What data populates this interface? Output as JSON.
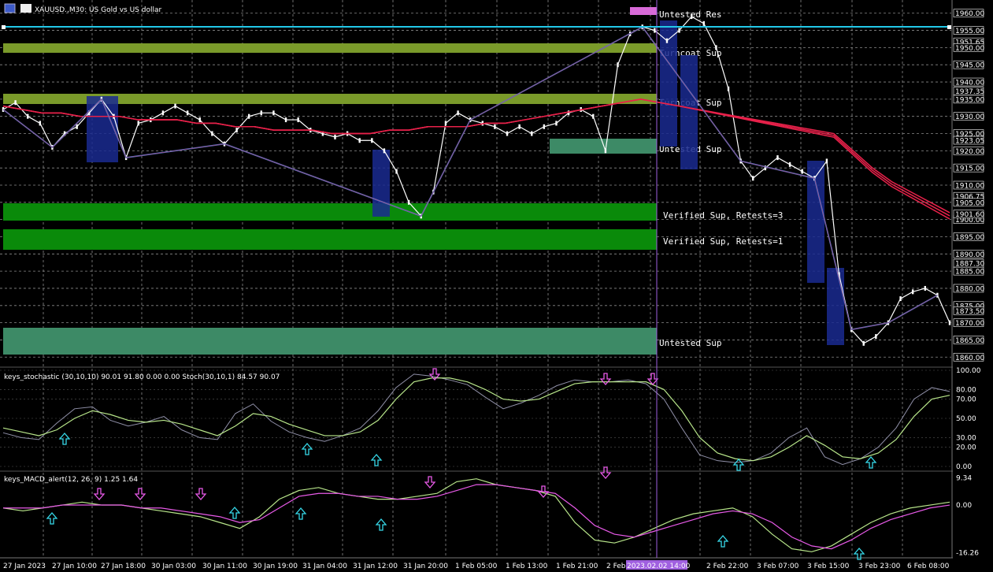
{
  "window": {
    "title": "XAUUSD.,M30: US Gold vs US dollar"
  },
  "main_pane": {
    "price_ticks": [
      "1960.00",
      "1955.00",
      "1951.65",
      "1950.00",
      "1945.00",
      "1940.00",
      "1937.35",
      "1935.00",
      "1930.00",
      "1925.00",
      "1923.05",
      "1920.00",
      "1915.00",
      "1910.00",
      "1906.75",
      "1905.00",
      "1900.00",
      "1901.60",
      "1895.00",
      "1890.00",
      "1887.30",
      "1885.00",
      "1880.00",
      "1875.00",
      "1873.50",
      "1870.00",
      "1865.00",
      "1860.00"
    ],
    "zones": [
      {
        "label": "Untested Res",
        "color": "#d86ad8"
      },
      {
        "label": "Turncoat Sup",
        "color": "#7a9a2a"
      },
      {
        "label": "Turncoat Sup",
        "color": "#7a9a2a"
      },
      {
        "label": "Untested Sup",
        "color": "#3d8a66"
      },
      {
        "label": "Verified Sup, Retests=3",
        "color": "#0a8a0a"
      },
      {
        "label": "Verified Sup, Retests=1",
        "color": "#0a8a0a"
      },
      {
        "label": "Untested Sup",
        "color": "#3d8a66"
      }
    ],
    "hline_price": "1955.00",
    "hline_color": "#22c8e8"
  },
  "stoch_pane": {
    "label": "keys_stochastic (30,10,10) 90.01 91.80 0.00 0.00 Stoch(30,10,1) 84.57 90.07",
    "ticks": [
      "100.00",
      "80.00",
      "70.00",
      "50.00",
      "30.00",
      "20.00",
      "0.00"
    ]
  },
  "macd_pane": {
    "label": "keys_MACD_alert(12, 26, 9) 1.25 1.64",
    "ticks": [
      "9.34",
      "0.00",
      "-16.26"
    ]
  },
  "time_axis": {
    "labels": [
      "27 Jan 2023",
      "27 Jan 10:00",
      "27 Jan 18:00",
      "30 Jan 03:00",
      "30 Jan 11:00",
      "30 Jan 19:00",
      "31 Jan 04:00",
      "31 Jan 12:00",
      "31 Jan 20:00",
      "1 Feb 05:00",
      "1 Feb 13:00",
      "1 Feb 21:00",
      "2 Feb",
      "3 Feb 07:00",
      "3 Feb 15:00",
      "3 Feb 23:00",
      "6 Feb 08:00"
    ],
    "highlight_label": "2023.02.02 14:00",
    "extra_label": "2 Feb 22:00"
  },
  "chart_data": {
    "type": "line",
    "title": "XAUUSD.,M30: US Gold vs US dollar",
    "ylim": [
      1858,
      1962
    ],
    "price_series": [
      1932,
      1934,
      1930,
      1928,
      1921,
      1925,
      1927,
      1931,
      1935,
      1930,
      1918,
      1928,
      1929,
      1931,
      1933,
      1931,
      1929,
      1925,
      1922,
      1926,
      1930,
      1931,
      1931,
      1929,
      1929,
      1926,
      1925,
      1924,
      1925,
      1923,
      1923,
      1920,
      1914,
      1905,
      1901,
      1908,
      1928,
      1931,
      1929,
      1928,
      1927,
      1925,
      1927,
      1925,
      1927,
      1928,
      1931,
      1932,
      1930,
      1920,
      1945,
      1954,
      1956,
      1955,
      1952,
      1955,
      1959,
      1957,
      1950,
      1938,
      1917,
      1912,
      1915,
      1918,
      1916,
      1914,
      1912,
      1917,
      1884,
      1868,
      1864,
      1866,
      1870,
      1877,
      1879,
      1880,
      1878,
      1870
    ],
    "ma_series": [
      {
        "color": "#e8214a",
        "values": [
          1933,
          1932,
          1931,
          1931,
          1930,
          1930,
          1930,
          1929,
          1929,
          1929,
          1928,
          1928,
          1927,
          1927,
          1926,
          1926,
          1926,
          1925,
          1925,
          1925,
          1926,
          1926,
          1927,
          1927,
          1927,
          1928,
          1928,
          1929,
          1930,
          1931,
          1932,
          1933,
          1934,
          1935,
          1934,
          1933,
          1932,
          1931,
          1930,
          1929,
          1928,
          1927,
          1926,
          1925,
          1920,
          1915,
          1911,
          1908,
          1905,
          1902
        ]
      }
    ],
    "stoch": {
      "ylim": [
        0,
        100
      ],
      "k": [
        35,
        30,
        28,
        45,
        60,
        62,
        48,
        42,
        46,
        52,
        38,
        30,
        28,
        55,
        65,
        47,
        36,
        30,
        26,
        32,
        40,
        58,
        82,
        96,
        94,
        90,
        85,
        72,
        60,
        66,
        74,
        84,
        90,
        88,
        88,
        90,
        86,
        70,
        40,
        12,
        6,
        4,
        6,
        14,
        30,
        40,
        10,
        2,
        8,
        20,
        40,
        70,
        82,
        78
      ],
      "d": [
        40,
        36,
        32,
        38,
        50,
        58,
        54,
        48,
        46,
        48,
        44,
        38,
        32,
        42,
        55,
        52,
        44,
        38,
        32,
        32,
        36,
        48,
        70,
        88,
        92,
        92,
        88,
        80,
        70,
        68,
        70,
        78,
        86,
        88,
        88,
        88,
        88,
        80,
        58,
        30,
        14,
        8,
        6,
        10,
        20,
        32,
        22,
        10,
        8,
        14,
        28,
        52,
        70,
        74
      ]
    },
    "macd": {
      "ylim": [
        -17,
        10
      ],
      "main": [
        -1,
        -2,
        -1,
        0,
        1,
        0,
        0,
        -1,
        -2,
        -3,
        -4,
        -6,
        -8,
        -4,
        2,
        5,
        6,
        4,
        3,
        2,
        2,
        3,
        4,
        8,
        9,
        7,
        6,
        5,
        3,
        -6,
        -12,
        -13,
        -11,
        -8,
        -5,
        -3,
        -2,
        -1,
        -4,
        -10,
        -15,
        -16,
        -14,
        -10,
        -6,
        -3,
        -1,
        0,
        1
      ],
      "signal": [
        -1,
        -1,
        -1,
        0,
        0,
        0,
        0,
        -1,
        -1,
        -2,
        -3,
        -4,
        -6,
        -5,
        -1,
        3,
        4,
        4,
        3,
        3,
        2,
        2,
        3,
        5,
        7,
        7,
        6,
        5,
        4,
        -1,
        -7,
        -10,
        -11,
        -9,
        -7,
        -5,
        -3,
        -2,
        -3,
        -6,
        -11,
        -14,
        -15,
        -12,
        -8,
        -5,
        -3,
        -1,
        0
      ]
    }
  }
}
